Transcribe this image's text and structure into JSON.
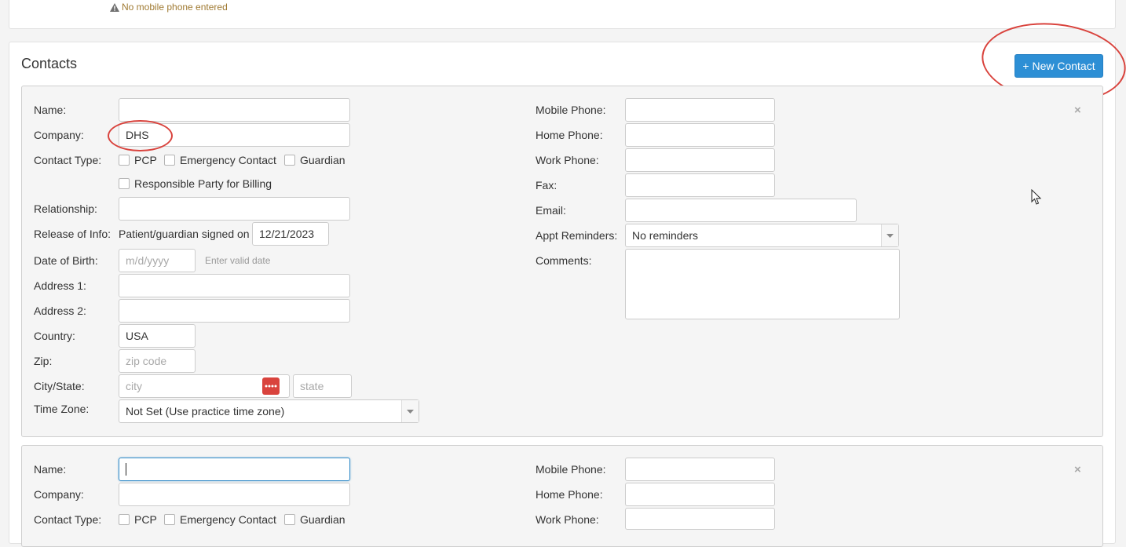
{
  "top_warning": "No mobile phone entered",
  "contacts": {
    "title": "Contacts",
    "new_button": "+ New Contact"
  },
  "labels": {
    "name": "Name:",
    "company": "Company:",
    "contact_type": "Contact Type:",
    "relationship": "Relationship:",
    "release": "Release of Info:",
    "dob": "Date of Birth:",
    "address1": "Address 1:",
    "address2": "Address 2:",
    "country": "Country:",
    "zip": "Zip:",
    "city_state": "City/State:",
    "time_zone": "Time Zone:",
    "mobile": "Mobile Phone:",
    "home": "Home Phone:",
    "work": "Work Phone:",
    "fax": "Fax:",
    "email": "Email:",
    "appt": "Appt Reminders:",
    "comments": "Comments:"
  },
  "contact_types": [
    "PCP",
    "Emergency Contact",
    "Guardian",
    "Responsible Party for Billing"
  ],
  "contact1": {
    "company": "DHS",
    "release_text": "Patient/guardian signed on",
    "release_date": "12/21/2023",
    "dob_placeholder": "m/d/yyyy",
    "dob_hint": "Enter valid date",
    "country": "USA",
    "zip_placeholder": "zip code",
    "city_placeholder": "city",
    "state_placeholder": "state",
    "time_zone": "Not Set (Use practice time zone)",
    "appt_reminders": "No reminders"
  },
  "close_symbol": "×",
  "icons": {
    "warning": "warning-triangle-icon",
    "locate": "dots-locate-icon",
    "dropdown": "chevron-down-icon",
    "close": "close-icon",
    "cursor": "mouse-pointer-icon"
  },
  "colors": {
    "primary_button": "#2d8fd5",
    "annotation_red": "#d9433d",
    "warning_text": "#a07a32"
  }
}
